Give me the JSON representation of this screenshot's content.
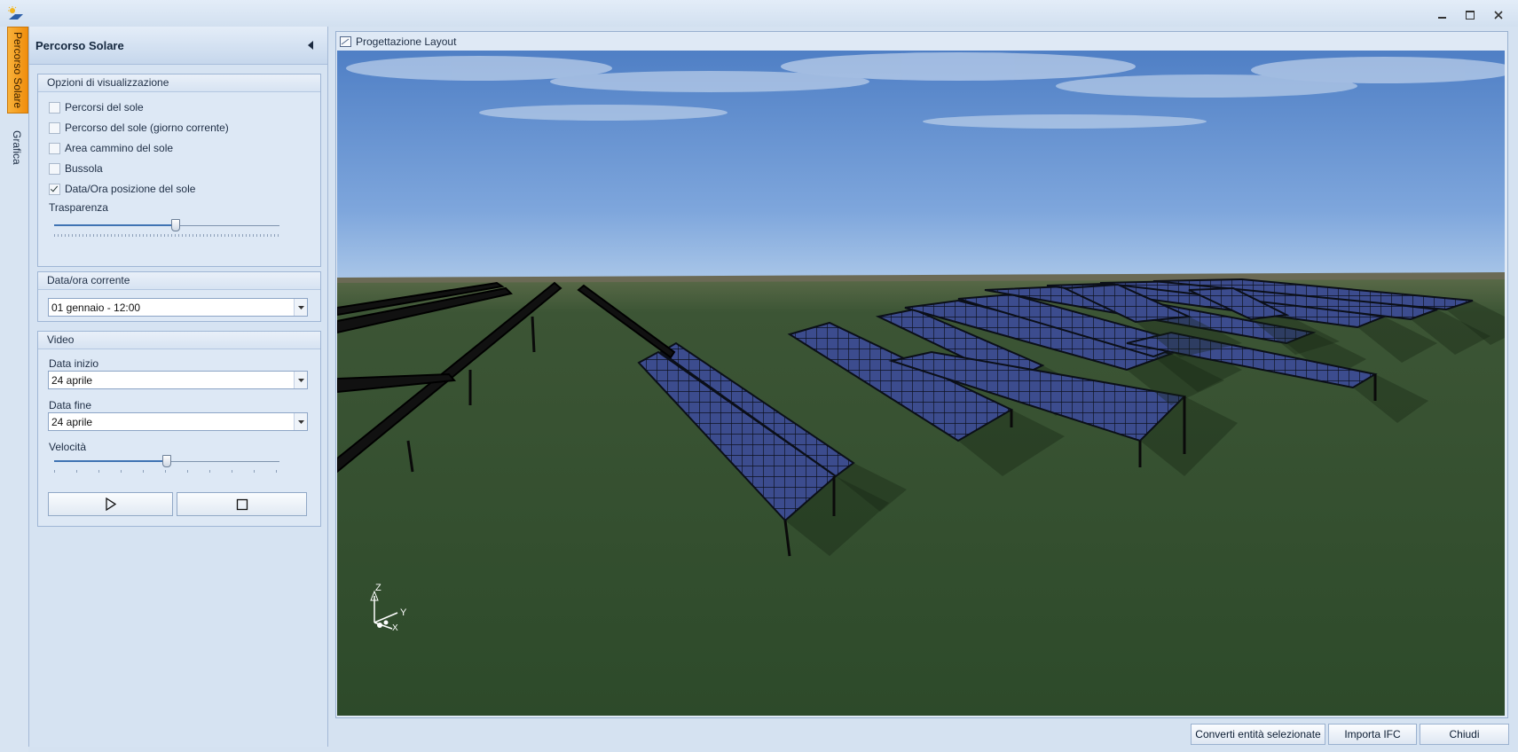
{
  "window": {
    "icon": "solar-app-icon",
    "buttons": [
      "minimize-icon",
      "restore-icon",
      "close-icon"
    ]
  },
  "side_tabs": [
    {
      "label": "Percorso Solare",
      "active": true
    },
    {
      "label": "Grafica",
      "active": false
    }
  ],
  "panel": {
    "title": "Percorso Solare",
    "display_options": {
      "header": "Opzioni di visualizzazione",
      "checkboxes": [
        {
          "label": "Percorsi del sole",
          "checked": false
        },
        {
          "label": "Percorso del sole (giorno corrente)",
          "checked": false
        },
        {
          "label": "Area cammino del sole",
          "checked": false
        },
        {
          "label": "Bussola",
          "checked": false
        },
        {
          "label": "Data/Ora posizione del sole",
          "checked": true
        }
      ],
      "transparency_label": "Trasparenza",
      "transparency_fraction": 0.54
    },
    "current_datetime": {
      "header": "Data/ora corrente",
      "value": "01 gennaio - 12:00"
    },
    "video": {
      "header": "Video",
      "start_label": "Data inizio",
      "start_value": "24 aprile",
      "end_label": "Data fine",
      "end_value": "24 aprile",
      "speed_label": "Velocità",
      "speed_fraction": 0.5,
      "play_icon": "play-icon",
      "stop_icon": "stop-icon"
    }
  },
  "viewport": {
    "title": "Progettazione Layout",
    "axes": {
      "z": "Z",
      "y": "Y",
      "x": "X"
    },
    "colors": {
      "sky_top": "#5f8fcf",
      "sky_horizon": "#a7c4e6",
      "ground": "#2f4a2c",
      "panel": "#3c4a8c"
    }
  },
  "bottom_buttons": [
    "Converti entità selezionate",
    "Importa IFC",
    "Chiudi"
  ]
}
